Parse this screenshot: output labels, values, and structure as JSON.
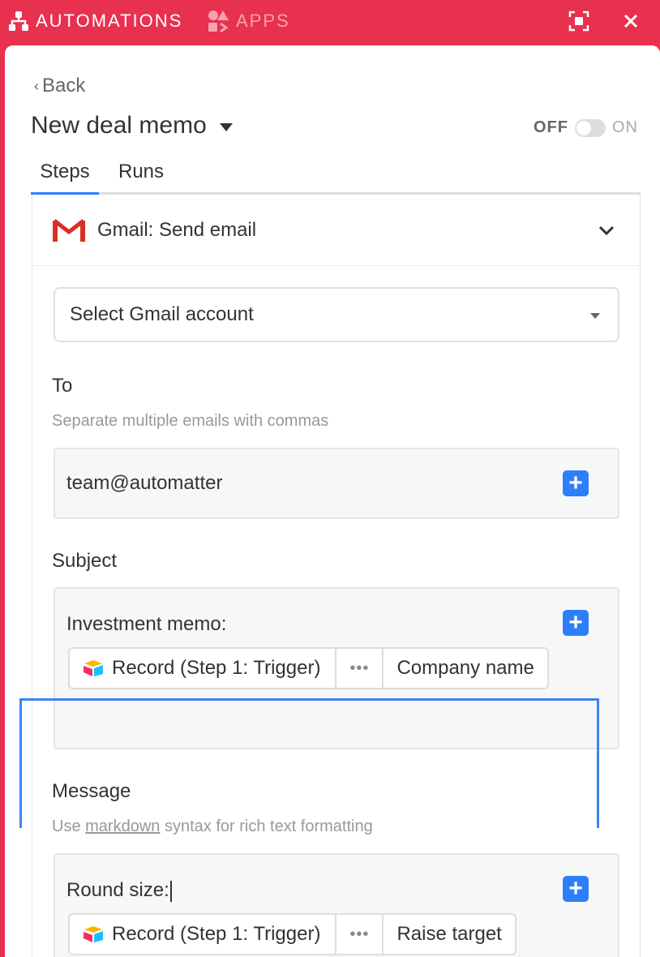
{
  "topbar": {
    "automations_label": "AUTOMATIONS",
    "apps_label": "APPS"
  },
  "header": {
    "back_label": "Back",
    "automation_title": "New deal memo",
    "toggle_off_label": "OFF",
    "toggle_on_label": "ON",
    "toggle_state": false
  },
  "tabs": [
    {
      "label": "Steps",
      "active": true
    },
    {
      "label": "Runs",
      "active": false
    }
  ],
  "step": {
    "title": "Gmail: Send email",
    "account_select": "Select Gmail account",
    "to": {
      "label": "To",
      "hint": "Separate multiple emails with commas",
      "value": "team@automatter"
    },
    "subject": {
      "label": "Subject",
      "text": "Investment memo:",
      "token": {
        "source": "Record (Step 1: Trigger)",
        "ellipsis": "•••",
        "field": "Company name"
      }
    },
    "message": {
      "label": "Message",
      "hint_prefix": "Use",
      "hint_link": "markdown",
      "hint_suffix": "syntax for rich text formatting",
      "text": "Round size:",
      "token": {
        "source": "Record (Step 1: Trigger)",
        "ellipsis": "•••",
        "field": "Raise target"
      }
    }
  },
  "colors": {
    "brand": "#e8304f",
    "accent": "#2d7ff9"
  }
}
